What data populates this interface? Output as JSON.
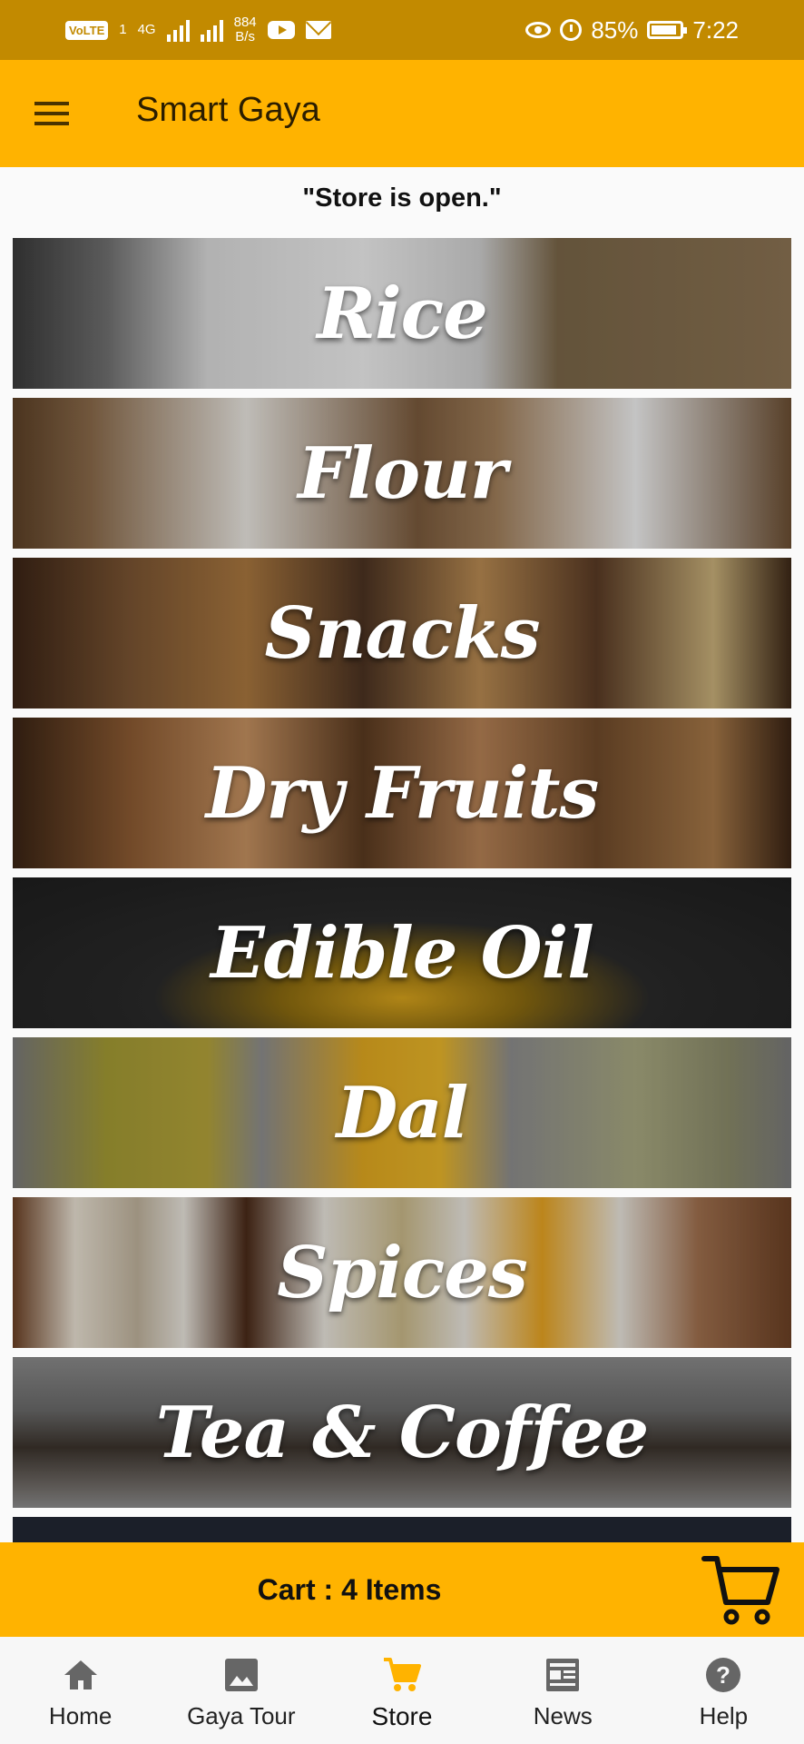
{
  "status_bar": {
    "volte": "VoLTE",
    "sim": "1",
    "network": "4G",
    "speed_value": "884",
    "speed_unit": "B/s",
    "battery": "85%",
    "time": "7:22"
  },
  "app_bar": {
    "title": "Smart Gaya"
  },
  "store_status": "\"Store is open.\"",
  "categories": [
    {
      "label": "Rice"
    },
    {
      "label": "Flour"
    },
    {
      "label": "Snacks"
    },
    {
      "label": "Dry Fruits"
    },
    {
      "label": "Edible Oil"
    },
    {
      "label": "Dal"
    },
    {
      "label": "Spices"
    },
    {
      "label": "Tea & Coffee"
    }
  ],
  "cart": {
    "label": "Cart : 4 Items"
  },
  "bottom_nav": {
    "items": [
      {
        "label": "Home",
        "icon": "home-icon"
      },
      {
        "label": "Gaya Tour",
        "icon": "image-icon"
      },
      {
        "label": "Store",
        "icon": "cart-icon"
      },
      {
        "label": "News",
        "icon": "newspaper-icon"
      },
      {
        "label": "Help",
        "icon": "help-icon"
      }
    ],
    "active": "Store"
  },
  "colors": {
    "accent": "#ffb300",
    "status_bar": "#c28a00",
    "active_nav": "#ffb300"
  }
}
